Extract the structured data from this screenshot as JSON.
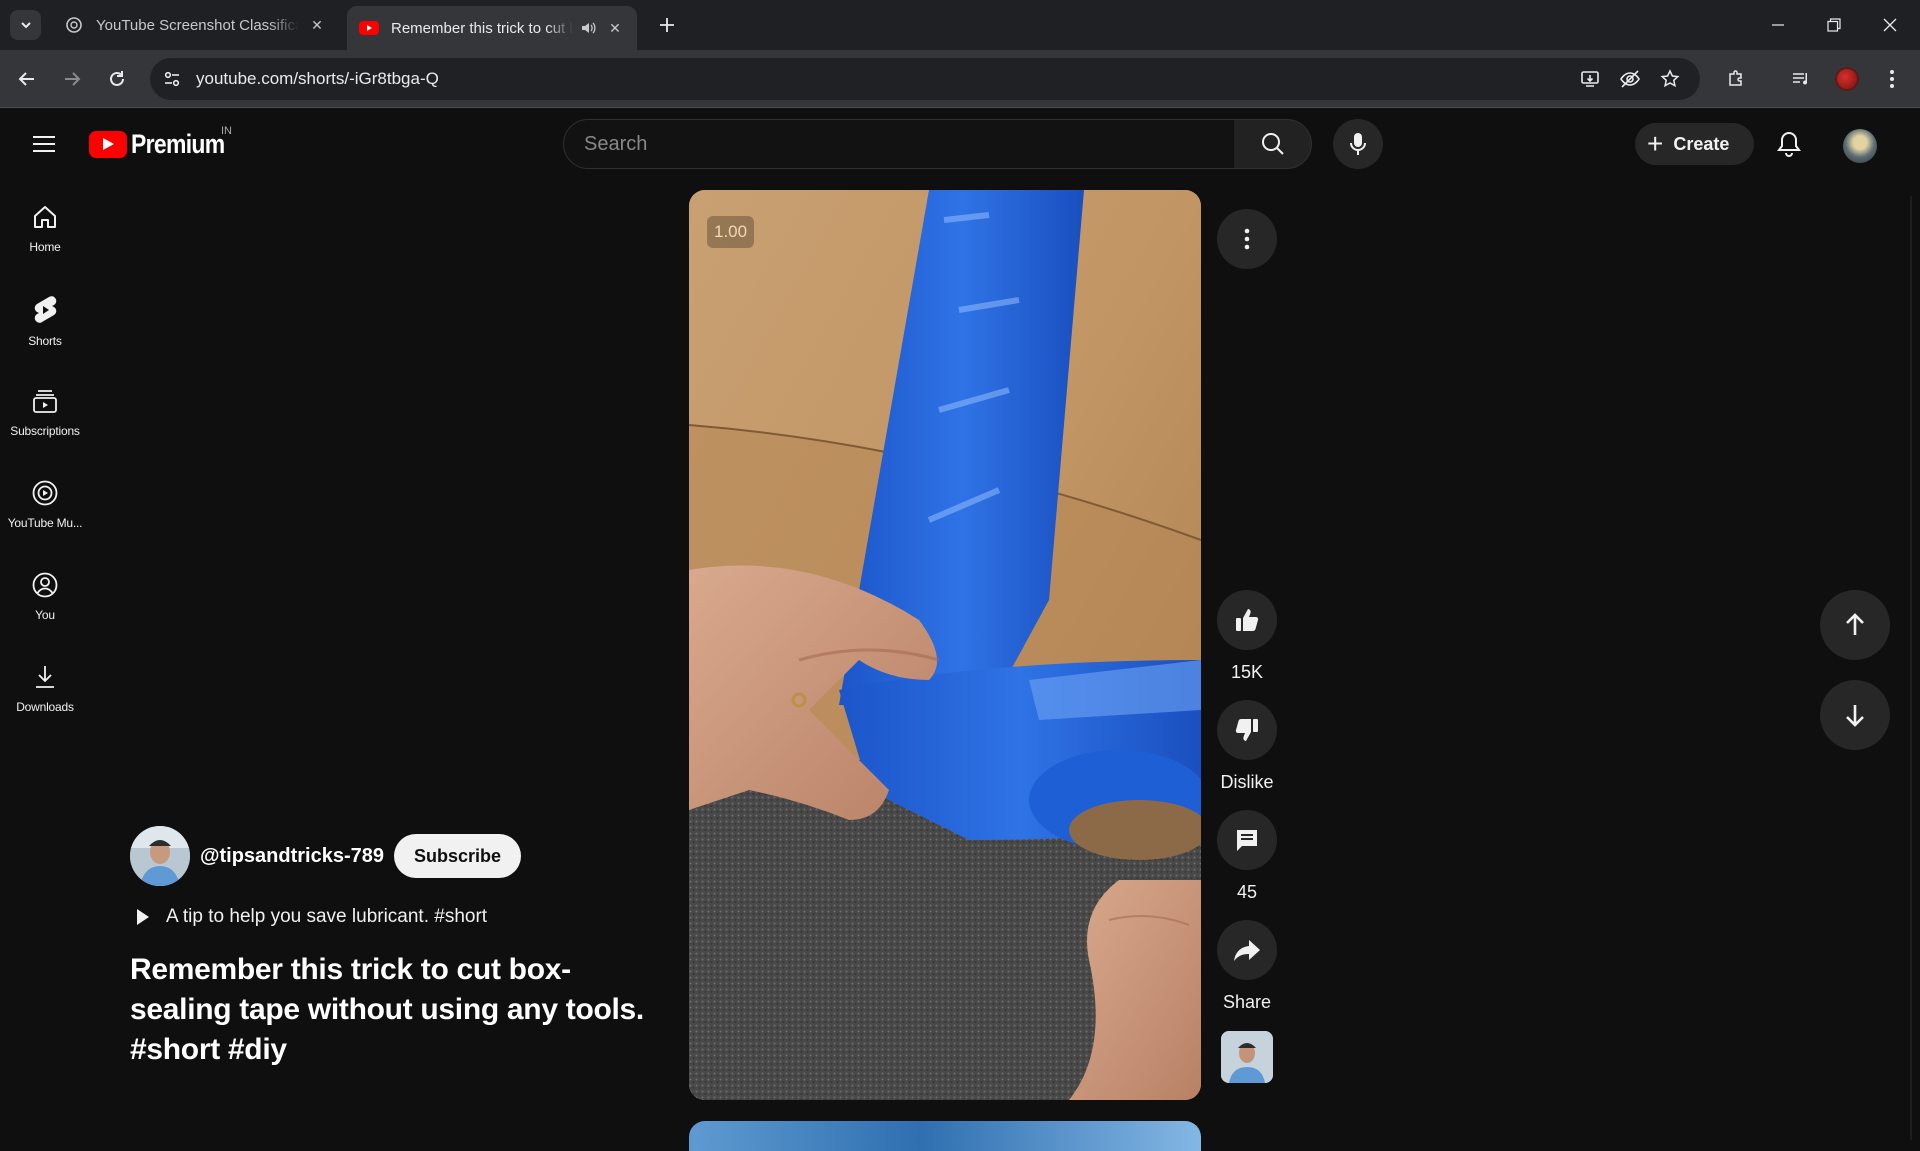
{
  "browser": {
    "tabs": [
      {
        "title": "YouTube Screenshot Classificati",
        "active": false
      },
      {
        "title": "Remember this trick to cut box-sealing",
        "active": true
      }
    ],
    "url": "youtube.com/shorts/-iGr8tbga-Q"
  },
  "masthead": {
    "logo_text": "Premium",
    "country_code": "IN",
    "search_placeholder": "Search",
    "create_label": "Create"
  },
  "guide": {
    "items": [
      {
        "label": "Home",
        "icon": "home-icon"
      },
      {
        "label": "Shorts",
        "icon": "shorts-icon"
      },
      {
        "label": "Subscriptions",
        "icon": "subscriptions-icon"
      },
      {
        "label": "YouTube Mu...",
        "icon": "youtube-music-icon"
      },
      {
        "label": "You",
        "icon": "you-icon"
      },
      {
        "label": "Downloads",
        "icon": "downloads-icon"
      }
    ]
  },
  "short": {
    "speed_label": "1.00",
    "channel_handle": "@tipsandtricks-789",
    "subscribe_label": "Subscribe",
    "description": "A tip to help you save lubricant. #short",
    "title": "Remember this trick to cut box-sealing tape without using any tools. #short #diy"
  },
  "actions": {
    "like_count": "15K",
    "dislike_label": "Dislike",
    "comment_count": "45",
    "share_label": "Share"
  },
  "colors": {
    "background": "#0f0f0f",
    "brand_red": "#ff0000",
    "chip": "#272727",
    "tape_blue": "#1f5fd6"
  }
}
